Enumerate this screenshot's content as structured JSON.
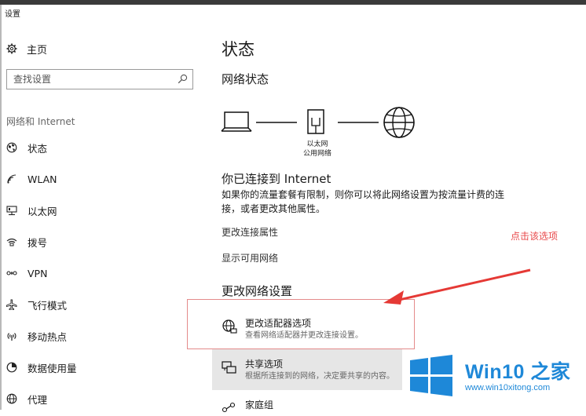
{
  "window": {
    "title": "设置"
  },
  "sidebar": {
    "home_label": "主页",
    "search_placeholder": "查找设置",
    "section_label": "网络和 Internet",
    "items": [
      {
        "label": "状态",
        "icon": "globe-icon"
      },
      {
        "label": "WLAN",
        "icon": "wifi-icon"
      },
      {
        "label": "以太网",
        "icon": "ethernet-icon"
      },
      {
        "label": "拨号",
        "icon": "dialup-icon"
      },
      {
        "label": "VPN",
        "icon": "vpn-icon"
      },
      {
        "label": "飞行模式",
        "icon": "airplane-icon"
      },
      {
        "label": "移动热点",
        "icon": "hotspot-icon"
      },
      {
        "label": "数据使用量",
        "icon": "data-usage-icon"
      },
      {
        "label": "代理",
        "icon": "proxy-globe-icon"
      }
    ]
  },
  "main": {
    "title": "状态",
    "network_status_heading": "网络状态",
    "diagram": {
      "adapter_label": "以太网",
      "network_label": "公用网络"
    },
    "connected_heading": "你已连接到 Internet",
    "description": "如果你的流量套餐有限制，则你可以将此网络设置为按流量计费的连接，或者更改其他属性。",
    "links": {
      "change_properties": "更改连接属性",
      "show_networks": "显示可用网络"
    },
    "change_settings_heading": "更改网络设置",
    "options": [
      {
        "title": "更改适配器选项",
        "desc": "查看网络适配器并更改连接设置。",
        "icon": "adapter-icon"
      },
      {
        "title": "共享选项",
        "desc": "根据所连接到的网络，决定要共享的内容。",
        "icon": "sharing-icon"
      },
      {
        "title": "家庭组",
        "desc": "",
        "icon": "homegroup-icon"
      }
    ]
  },
  "annotation": {
    "text": "点击该选项",
    "color": "#e8484a"
  },
  "watermark": {
    "title": "Win10 之家",
    "url": "www.win10xitong.com",
    "color": "#1e88d8"
  }
}
